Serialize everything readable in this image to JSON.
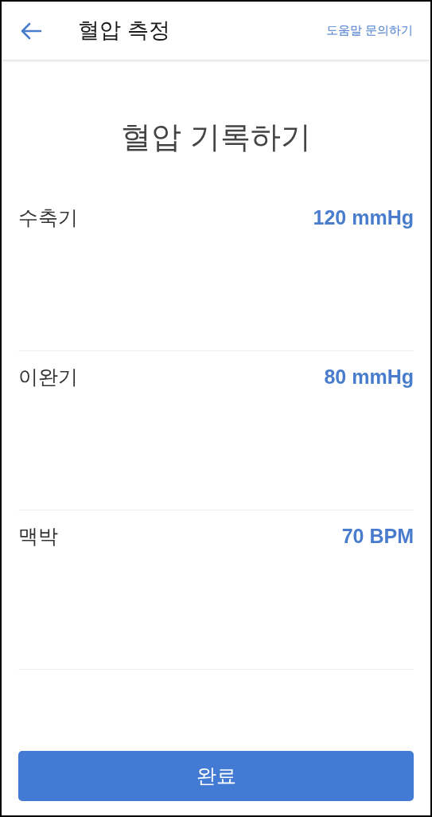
{
  "header": {
    "title": "혈압 측정",
    "help_link": "도움말 문의하기"
  },
  "heading": "혈압 기록하기",
  "measurements": [
    {
      "label": "수축기",
      "value": "120 mmHg"
    },
    {
      "label": "이완기",
      "value": "80 mmHg"
    },
    {
      "label": "맥박",
      "value": "70 BPM"
    }
  ],
  "button": "완료"
}
